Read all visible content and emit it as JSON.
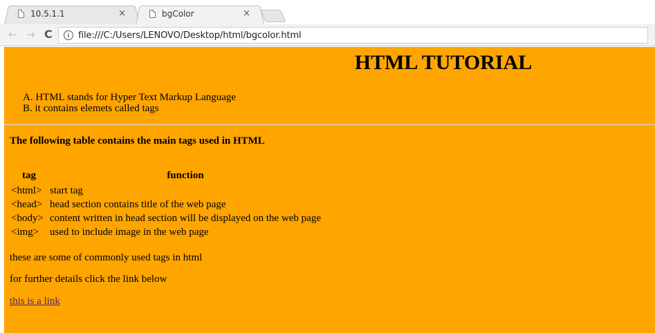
{
  "browser": {
    "tabs": [
      {
        "title": "10.5.1.1",
        "close": "×"
      },
      {
        "title": "bgColor",
        "close": "×"
      }
    ],
    "nav": {
      "back": "←",
      "forward": "→",
      "reload": "C"
    },
    "address": {
      "info": "i",
      "url": "file:///C:/Users/LENOVO/Desktop/html/bgcolor.html"
    }
  },
  "page": {
    "background_color": "#ffa500",
    "heading": "HTML TUTORIAL",
    "ordered_list": [
      {
        "marker": "A.",
        "text": "HTML stands for Hyper Text Markup Language"
      },
      {
        "marker": "B.",
        "text": "it contains elemets called tags"
      }
    ],
    "intro": "The following table contains the main tags used in HTML",
    "table": {
      "headers": [
        "tag",
        "function"
      ],
      "rows": [
        [
          "<html>",
          "start tag"
        ],
        [
          "<head>",
          "head section contains title of the web page"
        ],
        [
          "<body>",
          "content written in head section will be displayed on the web page"
        ],
        [
          "<img>",
          "used to include image in the web page"
        ]
      ]
    },
    "para1": "these are some of commonly used tags in html",
    "para2": "for further details click the link below",
    "link_text": "this is a link",
    "link_color": "#551a8b"
  }
}
